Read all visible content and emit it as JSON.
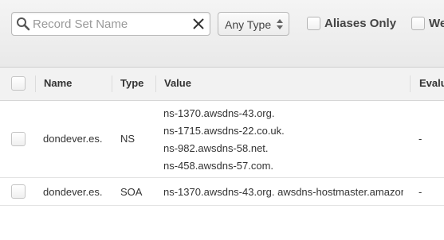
{
  "toolbar": {
    "search": {
      "placeholder": "Record Set Name",
      "value": "",
      "icon": "search-icon",
      "clear_icon": "close-icon"
    },
    "type_select": {
      "selected": "Any Type",
      "icon": "up-down-arrows-icon"
    },
    "aliases_only": {
      "label": "Aliases Only",
      "checked": false
    },
    "weighted": {
      "label": "We",
      "checked": false
    }
  },
  "table": {
    "columns": [
      "Name",
      "Type",
      "Value",
      "Evalu"
    ],
    "rows": [
      {
        "selected": false,
        "name": "dondever.es.",
        "type": "NS",
        "values": [
          "ns-1370.awsdns-43.org.",
          "ns-1715.awsdns-22.co.uk.",
          "ns-982.awsdns-58.net.",
          "ns-458.awsdns-57.com."
        ],
        "evaluate": "-"
      },
      {
        "selected": false,
        "name": "dondever.es.",
        "type": "SOA",
        "values": [
          "ns-1370.awsdns-43.org. awsdns-hostmaster.amazon"
        ],
        "evaluate": "-"
      }
    ]
  }
}
